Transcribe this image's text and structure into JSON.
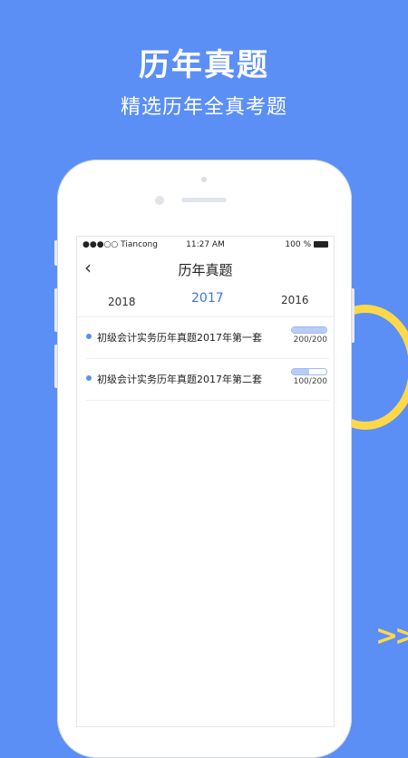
{
  "promo": {
    "headline": "历年真题",
    "subheadline": "精选历年全真考题"
  },
  "status_bar": {
    "carrier": "●●●○○ Tiancong",
    "time": "11:27 AM",
    "battery": "100 %"
  },
  "nav": {
    "back_icon": "chevron-left-icon",
    "title": "历年真题"
  },
  "year_tabs": {
    "items": [
      "2018",
      "2017",
      "2016"
    ],
    "selected": "2017"
  },
  "papers": [
    {
      "title": "初级会计实务历年真题2017年第一套",
      "progress_text": "200/200",
      "progress": 1.0
    },
    {
      "title": "初级会计实务历年真题2017年第二套",
      "progress_text": "100/200",
      "progress": 0.5
    }
  ],
  "colors": {
    "background": "#5b8ff5",
    "accent": "#3b76e0",
    "decoration": "#ffd84a"
  }
}
